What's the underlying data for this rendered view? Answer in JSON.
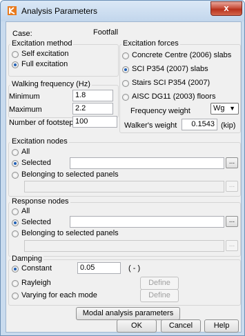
{
  "window": {
    "title": "Analysis Parameters",
    "close_glyph": "x"
  },
  "case": {
    "label": "Case:",
    "value": "Footfall"
  },
  "excitation_method": {
    "title": "Excitation method",
    "options": [
      {
        "label": "Self excitation",
        "selected": false
      },
      {
        "label": "Full excitation",
        "selected": true
      }
    ]
  },
  "walking_frequency": {
    "title": "Walking frequency (Hz)",
    "min_label": "Minimum",
    "min_value": "1.8",
    "max_label": "Maximum",
    "max_value": "2.2"
  },
  "footsteps": {
    "label": "Number of footsteps",
    "value": "100"
  },
  "excitation_forces": {
    "title": "Excitation forces",
    "options": [
      {
        "label": "Concrete Centre (2006) slabs",
        "selected": false
      },
      {
        "label": "SCI P354 (2007) slabs",
        "selected": true
      },
      {
        "label": "Stairs SCI P354 (2007)",
        "selected": false
      },
      {
        "label": "AISC DG11 (2003) floors",
        "selected": false
      }
    ],
    "freq_weight_label": "Frequency weight",
    "freq_weight_value": "Wg"
  },
  "walker_weight": {
    "label": "Walker's weight",
    "value": "0.1543",
    "unit": "(kip)"
  },
  "excitation_nodes": {
    "title": "Excitation nodes",
    "options": [
      {
        "label": "All",
        "selected": false
      },
      {
        "label": "Selected",
        "selected": true
      },
      {
        "label": "Belonging to selected panels",
        "selected": false
      }
    ],
    "browse_label": "...",
    "browse2_label": "..."
  },
  "response_nodes": {
    "title": "Response nodes",
    "options": [
      {
        "label": "All",
        "selected": false
      },
      {
        "label": "Selected",
        "selected": true
      },
      {
        "label": "Belonging to selected panels",
        "selected": false
      }
    ],
    "browse_label": "...",
    "browse2_label": "..."
  },
  "damping": {
    "title": "Damping",
    "options": [
      {
        "label": "Constant",
        "selected": true
      },
      {
        "label": "Rayleigh",
        "selected": false
      },
      {
        "label": "Varying for each mode",
        "selected": false
      }
    ],
    "constant_value": "0.05",
    "unit": "( - )",
    "define_label": "Define",
    "define2_label": "Define"
  },
  "buttons": {
    "modal": "Modal analysis parameters",
    "ok": "OK",
    "cancel": "Cancel",
    "help": "Help"
  },
  "colors": {
    "accent": "#1f5fb5",
    "titlebar": "#c9dbee",
    "close": "#c8503c"
  }
}
